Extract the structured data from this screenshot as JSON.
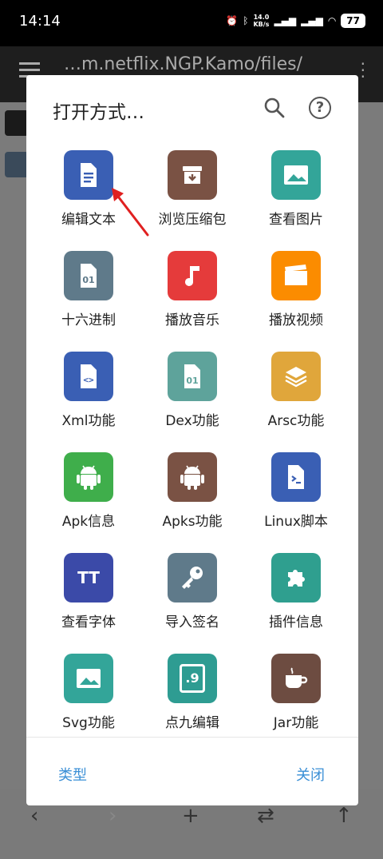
{
  "status": {
    "time": "14:14",
    "speed_top": "14.0",
    "speed_bottom": "KB/s",
    "battery": "77"
  },
  "background": {
    "path": "…m.netflix.NGP.Kamo/files/"
  },
  "dialog": {
    "title": "打开方式…",
    "items": [
      {
        "label": "编辑文本",
        "color": "#3a5fb4",
        "icon": "document-icon"
      },
      {
        "label": "浏览压缩包",
        "color": "#7a5244",
        "icon": "archive-icon"
      },
      {
        "label": "查看图片",
        "color": "#33a599",
        "icon": "image-icon"
      },
      {
        "label": "十六进制",
        "color": "#5f7a8a",
        "icon": "hex-file-icon",
        "glyph": "01"
      },
      {
        "label": "播放音乐",
        "color": "#e53b3b",
        "icon": "music-icon"
      },
      {
        "label": "播放视频",
        "color": "#fb8c00",
        "icon": "video-icon"
      },
      {
        "label": "Xml功能",
        "color": "#3a5fb4",
        "icon": "xml-file-icon"
      },
      {
        "label": "Dex功能",
        "color": "#5ea39b",
        "icon": "dex-file-icon",
        "glyph": "01"
      },
      {
        "label": "Arsc功能",
        "color": "#e0a63b",
        "icon": "layers-icon"
      },
      {
        "label": "Apk信息",
        "color": "#3fae4b",
        "icon": "android-icon"
      },
      {
        "label": "Apks功能",
        "color": "#7a5244",
        "icon": "android-icon"
      },
      {
        "label": "Linux脚本",
        "color": "#3a5fb4",
        "icon": "script-file-icon"
      },
      {
        "label": "查看字体",
        "color": "#3b4aa8",
        "icon": "font-icon",
        "glyph": "TT"
      },
      {
        "label": "导入签名",
        "color": "#5f7a8a",
        "icon": "key-icon"
      },
      {
        "label": "插件信息",
        "color": "#2f9f8f",
        "icon": "puzzle-icon"
      },
      {
        "label": "Svg功能",
        "color": "#33a599",
        "icon": "image-icon"
      },
      {
        "label": "点九编辑",
        "color": "#2e9c92",
        "icon": "ninepatch-icon",
        "glyph": ".9"
      },
      {
        "label": "Jar功能",
        "color": "#6d4c41",
        "icon": "coffee-icon"
      }
    ],
    "footer": {
      "type_label": "类型",
      "close_label": "关闭"
    }
  }
}
